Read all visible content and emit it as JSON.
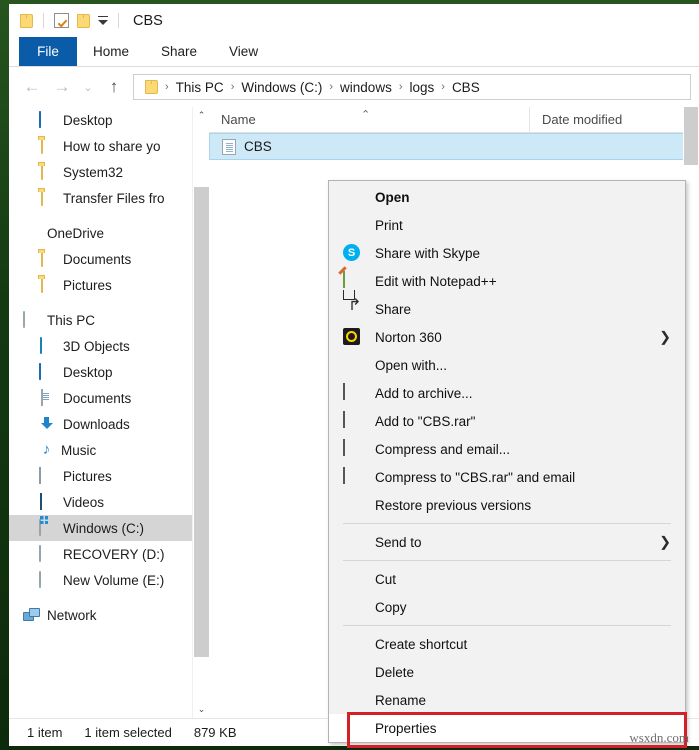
{
  "window": {
    "title": "CBS",
    "quick_access": {
      "folder_icon": "folder-icon",
      "checkbox_icon": "checkbox-properties-icon",
      "folder2_icon": "folder-icon",
      "dropdown_icon": "customize-quick-access-chevron-icon"
    }
  },
  "ribbon": {
    "tabs": [
      {
        "label": "File",
        "active": true
      },
      {
        "label": "Home",
        "active": false
      },
      {
        "label": "Share",
        "active": false
      },
      {
        "label": "View",
        "active": false
      }
    ]
  },
  "nav": {
    "back_icon": "back-arrow-icon",
    "forward_icon": "forward-arrow-icon",
    "recent_icon": "recent-locations-chevron-icon",
    "up_icon": "up-arrow-icon",
    "address": {
      "folder_icon": "folder-icon",
      "crumbs": [
        "This PC",
        "Windows (C:)",
        "windows",
        "logs",
        "CBS"
      ],
      "separator": "›"
    }
  },
  "sidebar": {
    "scroll": {
      "up_icon": "chevron-up-icon",
      "down_icon": "chevron-down-icon"
    },
    "items": [
      {
        "label": "Desktop",
        "icon": "desktop-icon",
        "indent": "child",
        "selected": false
      },
      {
        "label": "How to share yo",
        "icon": "folder-icon",
        "indent": "child",
        "selected": false
      },
      {
        "label": "System32",
        "icon": "folder-icon",
        "indent": "child",
        "selected": false
      },
      {
        "label": "Transfer Files fro",
        "icon": "folder-icon",
        "indent": "child",
        "selected": false
      },
      {
        "label": "OneDrive",
        "icon": "onedrive-icon",
        "indent": "root",
        "selected": false
      },
      {
        "label": "Documents",
        "icon": "folder-icon",
        "indent": "child",
        "selected": false
      },
      {
        "label": "Pictures",
        "icon": "folder-icon",
        "indent": "child",
        "selected": false
      },
      {
        "label": "This PC",
        "icon": "this-pc-icon",
        "indent": "root",
        "selected": false
      },
      {
        "label": "3D Objects",
        "icon": "3d-objects-icon",
        "indent": "child",
        "selected": false
      },
      {
        "label": "Desktop",
        "icon": "desktop-icon",
        "indent": "child",
        "selected": false
      },
      {
        "label": "Documents",
        "icon": "documents-icon",
        "indent": "child",
        "selected": false
      },
      {
        "label": "Downloads",
        "icon": "downloads-icon",
        "indent": "child",
        "selected": false
      },
      {
        "label": "Music",
        "icon": "music-icon",
        "indent": "child",
        "selected": false
      },
      {
        "label": "Pictures",
        "icon": "pictures-icon",
        "indent": "child",
        "selected": false
      },
      {
        "label": "Videos",
        "icon": "videos-icon",
        "indent": "child",
        "selected": false
      },
      {
        "label": "Windows (C:)",
        "icon": "windows-drive-icon",
        "indent": "child",
        "selected": true
      },
      {
        "label": "RECOVERY (D:)",
        "icon": "drive-icon",
        "indent": "child",
        "selected": false
      },
      {
        "label": "New Volume (E:)",
        "icon": "drive-icon",
        "indent": "child",
        "selected": false
      },
      {
        "label": "Network",
        "icon": "network-icon",
        "indent": "root",
        "selected": false
      }
    ]
  },
  "filelist": {
    "columns": [
      {
        "label": "Name",
        "sorted": true,
        "sort_icon": "sort-ascending-caret-icon"
      },
      {
        "label": "Date modified",
        "sorted": false
      }
    ],
    "rows": [
      {
        "name": "CBS",
        "icon": "text-file-icon",
        "date_modified": "",
        "selected": true
      }
    ]
  },
  "contextmenu": {
    "items": [
      {
        "label": "Open",
        "icon": "",
        "bold": true,
        "submenu": false,
        "separator_after": false
      },
      {
        "label": "Print",
        "icon": "",
        "bold": false,
        "submenu": false,
        "separator_after": false
      },
      {
        "label": "Share with Skype",
        "icon": "skype-icon",
        "bold": false,
        "submenu": false,
        "separator_after": false
      },
      {
        "label": "Edit with Notepad++",
        "icon": "notepadpp-icon",
        "bold": false,
        "submenu": false,
        "separator_after": false
      },
      {
        "label": "Share",
        "icon": "share-icon",
        "bold": false,
        "submenu": false,
        "separator_after": false
      },
      {
        "label": "Norton 360",
        "icon": "norton-icon",
        "bold": false,
        "submenu": true,
        "separator_after": false
      },
      {
        "label": "Open with...",
        "icon": "",
        "bold": false,
        "submenu": false,
        "separator_after": false
      },
      {
        "label": "Add to archive...",
        "icon": "winrar-icon",
        "bold": false,
        "submenu": false,
        "separator_after": false
      },
      {
        "label": "Add to \"CBS.rar\"",
        "icon": "winrar-icon",
        "bold": false,
        "submenu": false,
        "separator_after": false
      },
      {
        "label": "Compress and email...",
        "icon": "winrar-icon",
        "bold": false,
        "submenu": false,
        "separator_after": false
      },
      {
        "label": "Compress to \"CBS.rar\" and email",
        "icon": "winrar-icon",
        "bold": false,
        "submenu": false,
        "separator_after": false
      },
      {
        "label": "Restore previous versions",
        "icon": "",
        "bold": false,
        "submenu": false,
        "separator_after": true
      },
      {
        "label": "Send to",
        "icon": "",
        "bold": false,
        "submenu": true,
        "separator_after": true
      },
      {
        "label": "Cut",
        "icon": "",
        "bold": false,
        "submenu": false,
        "separator_after": false
      },
      {
        "label": "Copy",
        "icon": "",
        "bold": false,
        "submenu": false,
        "separator_after": true
      },
      {
        "label": "Create shortcut",
        "icon": "",
        "bold": false,
        "submenu": false,
        "separator_after": false
      },
      {
        "label": "Delete",
        "icon": "uac-shield-icon",
        "bold": false,
        "submenu": false,
        "separator_after": false
      },
      {
        "label": "Rename",
        "icon": "uac-shield-icon",
        "bold": false,
        "submenu": false,
        "separator_after": false
      },
      {
        "label": "Properties",
        "icon": "",
        "bold": false,
        "submenu": false,
        "separator_after": false,
        "highlighted": true
      }
    ]
  },
  "statusbar": {
    "item_count": "1 item",
    "selection": "1 item selected",
    "size": "879 KB"
  },
  "annotation": {
    "highlight_color": "#d42027",
    "watermark": "wsxdn.com"
  }
}
